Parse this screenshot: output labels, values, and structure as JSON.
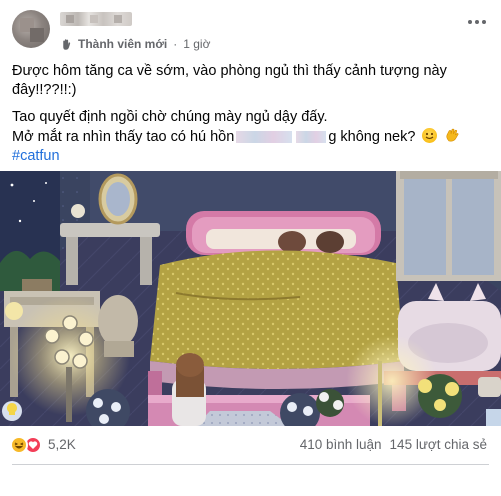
{
  "post": {
    "author_role": "Thành viên mới",
    "separator": "·",
    "time": "1 giờ",
    "line1": "Được hôm tăng ca về sớm, vào phòng ngủ thì thấy cảnh tượng này đây!!??!!:)",
    "line2": "Tao quyết định ngồi chờ chúng mày ngủ dậy đấy.",
    "line3_start": "Mở mắt ra nhìn thấy tao có hú hồn",
    "line3_end": "g không nek?",
    "hashtag": "#catfun",
    "icons": [
      "group-member-icon",
      "more-options-icon",
      "smile-emoji-icon",
      "wave-emoji-icon"
    ]
  },
  "footer": {
    "reaction_count": "5,2K",
    "comments": "410 bình luận",
    "shares": "145 lượt chia sẻ",
    "reaction_icons": [
      "haha-reaction-icon",
      "love-reaction-icon"
    ]
  },
  "colors": {
    "hashtag": "#216fdb",
    "secondary_text": "#65676b",
    "haha": "#f7b928",
    "love": "#f33e58"
  }
}
